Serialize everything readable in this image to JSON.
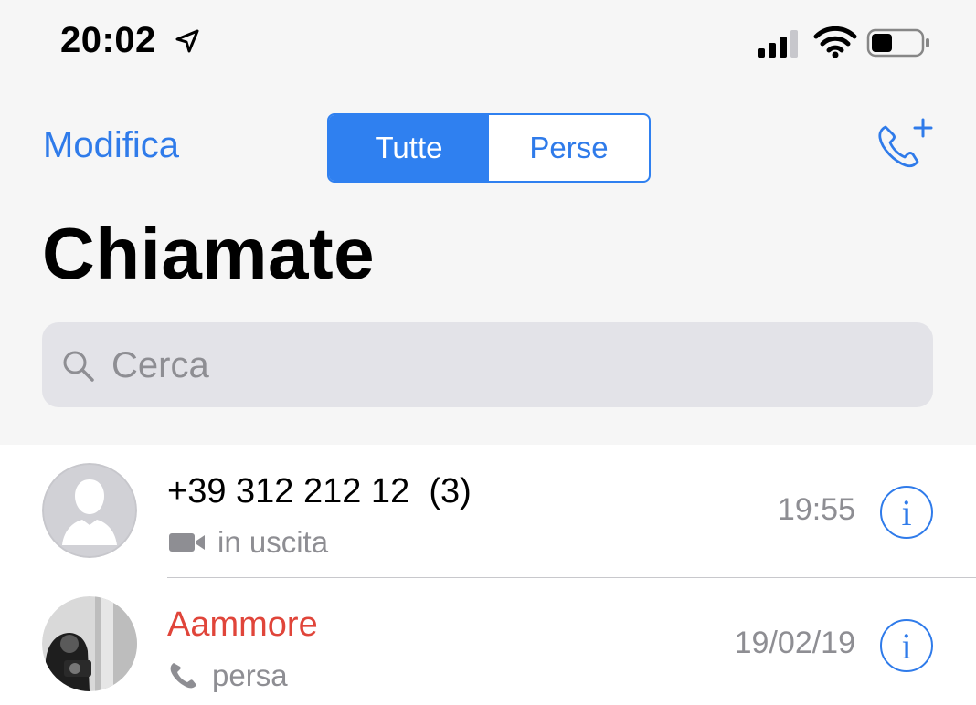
{
  "status_bar": {
    "time": "20:02"
  },
  "nav": {
    "edit_label": "Modifica",
    "segments": [
      {
        "label": "Tutte",
        "active": true
      },
      {
        "label": "Perse",
        "active": false
      }
    ],
    "new_call_icon": "phone-plus-icon"
  },
  "page": {
    "title": "Chiamate"
  },
  "search": {
    "placeholder": "Cerca",
    "value": ""
  },
  "calls": [
    {
      "name": "+39 312 212 12  (3)",
      "missed": false,
      "type_icon": "video-camera-icon",
      "type_label": "in uscita",
      "time": "19:55",
      "info_label": "i"
    },
    {
      "name": "Aammore",
      "missed": true,
      "type_icon": "phone-icon",
      "type_label": "persa",
      "time": "19/02/19",
      "info_label": "i"
    }
  ],
  "colors": {
    "accent": "#2f7bea",
    "missed": "#e0453a",
    "secondary_text": "#8e8e93",
    "header_bg": "#f6f6f6",
    "search_bg": "#e3e3e8"
  }
}
